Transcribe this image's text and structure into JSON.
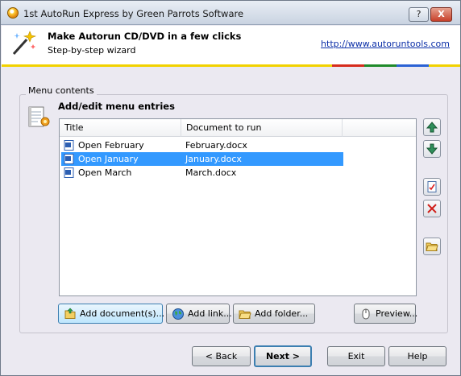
{
  "window": {
    "title": "1st AutoRun Express by Green Parrots Software",
    "help_label": "?",
    "close_label": "X"
  },
  "header": {
    "title": "Make Autorun CD/DVD in a few clicks",
    "subtitle": "Step-by-step wizard",
    "link": "http://www.autoruntools.com",
    "stripe_colors": [
      "#f2d200",
      "#d62b1c",
      "#1f8a2a",
      "#2b62d4",
      "#f2d200"
    ]
  },
  "group": {
    "title": "Menu contents",
    "heading": "Add/edit menu entries"
  },
  "list": {
    "columns": [
      "Title",
      "Document to run"
    ],
    "rows": [
      {
        "title": "Open February",
        "doc": "February.docx",
        "selected": false
      },
      {
        "title": "Open January",
        "doc": "January.docx",
        "selected": true
      },
      {
        "title": "Open March",
        "doc": "March.docx",
        "selected": false
      }
    ],
    "selection_color": "#3399ff"
  },
  "side_buttons": [
    "move-up-icon",
    "move-down-icon",
    "edit-icon",
    "delete-icon",
    "open-folder-icon"
  ],
  "actions": {
    "add_document": "Add document(s)...",
    "add_link": "Add link...",
    "add_folder": "Add folder...",
    "preview": "Preview..."
  },
  "nav": {
    "back": "< Back",
    "next": "Next >",
    "exit": "Exit",
    "help": "Help"
  }
}
